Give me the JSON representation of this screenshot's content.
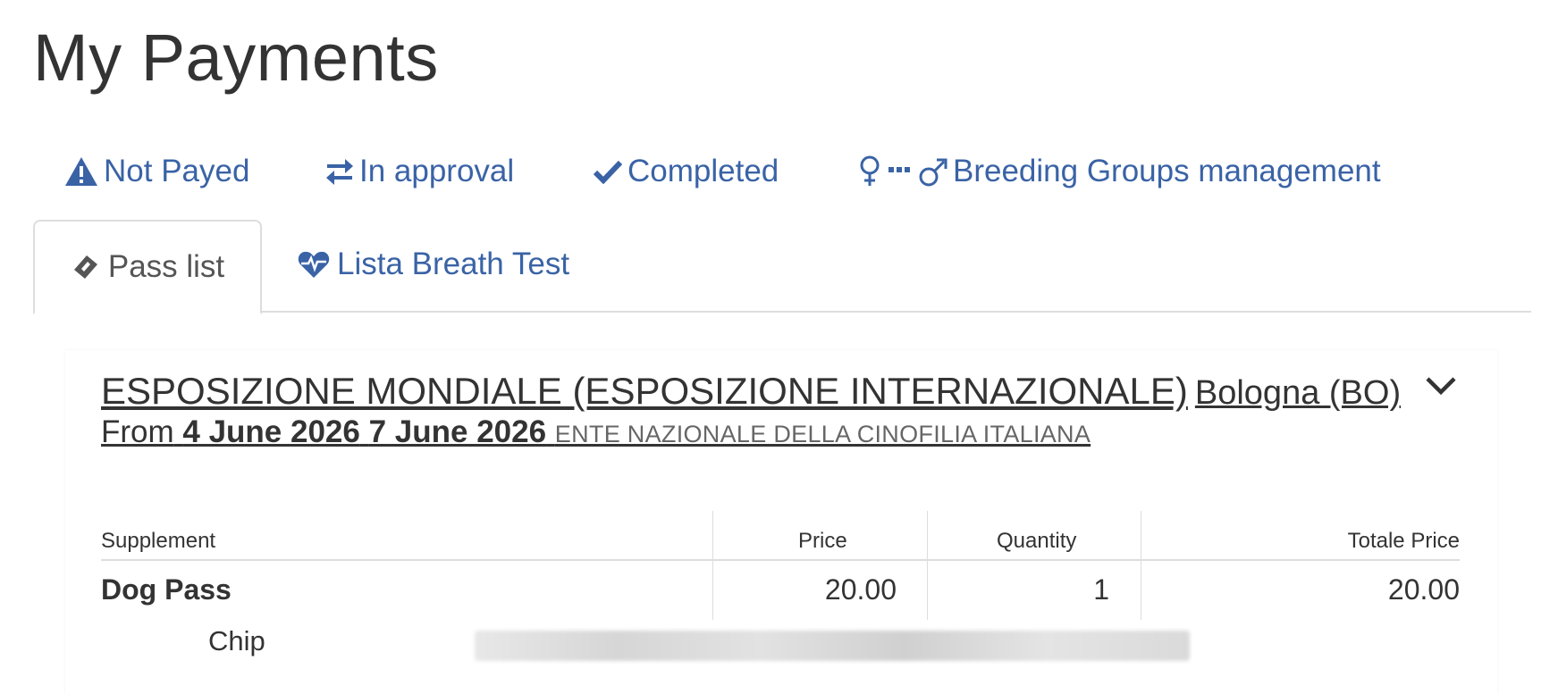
{
  "page": {
    "title": "My Payments"
  },
  "status_nav": [
    {
      "label": "Not Payed",
      "icon": "warning-icon"
    },
    {
      "label": "In approval",
      "icon": "exchange-icon"
    },
    {
      "label": "Completed",
      "icon": "check-icon"
    },
    {
      "label": "Breeding Groups management",
      "icon": "female-male-icon"
    }
  ],
  "tabs": [
    {
      "label": "Pass list",
      "icon": "ticket-icon",
      "active": true
    },
    {
      "label": "Lista Breath Test",
      "icon": "heartbeat-icon",
      "active": false
    }
  ],
  "event": {
    "title": "ESPOSIZIONE MONDIALE (ESPOSIZIONE INTERNAZIONALE)",
    "place": "Bologna (BO)",
    "from_label": "From",
    "start_date": "4 June 2026",
    "end_date": "7 June 2026",
    "organizer": "ENTE NAZIONALE DELLA CINOFILIA ITALIANA"
  },
  "table": {
    "headers": {
      "supplement": "Supplement",
      "price": "Price",
      "quantity": "Quantity",
      "total": "Totale Price"
    },
    "rows": [
      {
        "supplement": "Dog Pass",
        "price": "20.00",
        "quantity": "1",
        "total": "20.00"
      }
    ],
    "sub_label": "Chip"
  },
  "colors": {
    "link": "#3a63a6",
    "text": "#333333",
    "border": "#dddddd"
  }
}
